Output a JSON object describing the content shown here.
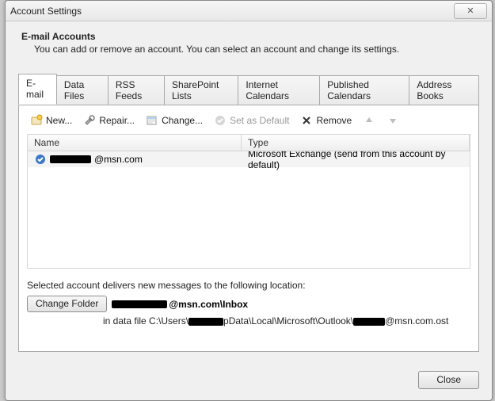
{
  "window": {
    "title": "Account Settings",
    "close_glyph": "✕"
  },
  "header": {
    "title": "E-mail Accounts",
    "subtitle": "You can add or remove an account. You can select an account and change its settings."
  },
  "tabs": [
    {
      "label": "E-mail",
      "active": true
    },
    {
      "label": "Data Files"
    },
    {
      "label": "RSS Feeds"
    },
    {
      "label": "SharePoint Lists"
    },
    {
      "label": "Internet Calendars"
    },
    {
      "label": "Published Calendars"
    },
    {
      "label": "Address Books"
    }
  ],
  "toolbar": {
    "new": "New...",
    "repair": "Repair...",
    "change": "Change...",
    "set_default": "Set as Default",
    "remove": "Remove"
  },
  "columns": {
    "name": "Name",
    "type": "Type"
  },
  "accounts": [
    {
      "name_suffix": "@msn.com",
      "type": "Microsoft Exchange (send from this account by default)",
      "default": true
    }
  ],
  "delivery": {
    "text": "Selected account delivers new messages to the following location:",
    "change_folder": "Change Folder",
    "folder_suffix": "@msn.com\\Inbox",
    "datafile_prefix": "in data file C:\\Users\\",
    "datafile_mid": "pData\\Local\\Microsoft\\Outlook\\",
    "datafile_suffix": "@msn.com.ost"
  },
  "footer": {
    "close": "Close"
  }
}
